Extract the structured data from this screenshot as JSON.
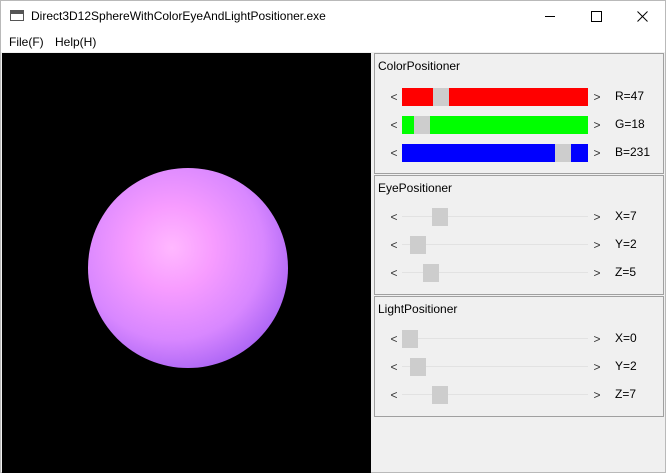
{
  "window": {
    "title": "Direct3D12SphereWithColorEyeAndLightPositioner.exe"
  },
  "menu": [
    {
      "label": "File(F)"
    },
    {
      "label": "Help(H)"
    }
  ],
  "color_positioner": {
    "title": "ColorPositioner",
    "rows": [
      {
        "label": "R=47",
        "value": 47,
        "color": "#ff0000",
        "arrow_left": "<",
        "arrow_right": ">"
      },
      {
        "label": "G=18",
        "value": 18,
        "color": "#00ff00",
        "arrow_left": "<",
        "arrow_right": ">"
      },
      {
        "label": "B=231",
        "value": 231,
        "color": "#0000ff",
        "arrow_left": "<",
        "arrow_right": ">"
      }
    ],
    "range": [
      0,
      255
    ]
  },
  "eye_positioner": {
    "title": "EyePositioner",
    "rows": [
      {
        "label": "X=7",
        "arrow_left": "<",
        "arrow_right": ">"
      },
      {
        "label": "Y=2",
        "arrow_left": "<",
        "arrow_right": ">"
      },
      {
        "label": "Z=5",
        "arrow_left": "<",
        "arrow_right": ">"
      }
    ]
  },
  "light_positioner": {
    "title": "LightPositioner",
    "rows": [
      {
        "label": "X=0",
        "arrow_left": "<",
        "arrow_right": ">"
      },
      {
        "label": "Y=2",
        "arrow_left": "<",
        "arrow_right": ">"
      },
      {
        "label": "Z=7",
        "arrow_left": "<",
        "arrow_right": ">"
      }
    ]
  },
  "scene": {
    "background": "#000000",
    "sphere_color": "#e8a0ff"
  }
}
